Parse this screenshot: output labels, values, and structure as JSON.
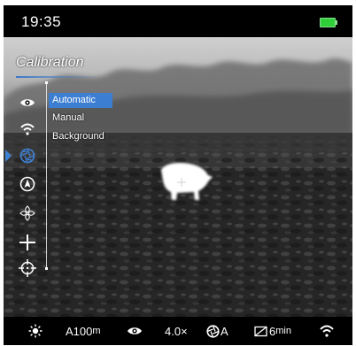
{
  "status": {
    "time": "19:35",
    "battery_color": "#2fcf3a"
  },
  "menu": {
    "title": "Calibration",
    "accent_color": "#3c7ed2",
    "side_icons": [
      "eye-icon",
      "wifi-icon",
      "aperture-icon",
      "compass-icon",
      "sensor-icon",
      "crosshair-icon",
      "target-icon"
    ],
    "active_icon": "aperture-icon",
    "options": [
      "Automatic",
      "Manual",
      "Background"
    ],
    "selected_option": "Automatic"
  },
  "bottom_bar": {
    "brightness_icon": "sun-icon",
    "distance_value": "A100",
    "distance_unit": "m",
    "mode_icon": "eye-icon",
    "zoom": "4.0×",
    "calibration_icon": "aperture-icon",
    "calibration_mode": "A",
    "timer_icon": "display-off-icon",
    "timer_value": "6",
    "timer_unit": "min",
    "wifi_icon": "wifi-icon"
  }
}
